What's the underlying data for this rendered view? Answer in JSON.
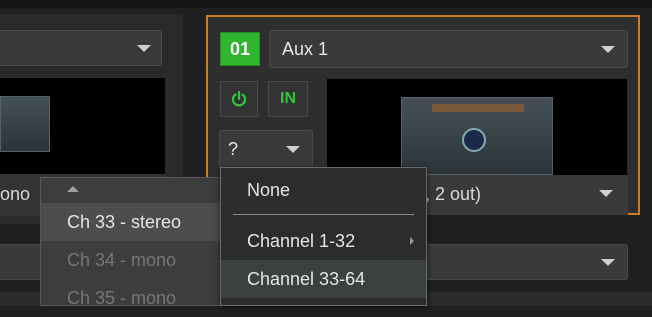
{
  "left_panel": {
    "dropdown_value": "",
    "partial_label": "ono"
  },
  "right_panel": {
    "track_number": "01",
    "name_dropdown": "Aux 1",
    "power_icon": "power-icon",
    "in_button": "IN",
    "help_select": "?",
    "plugin_label": ", 2 out)"
  },
  "menu_channels": {
    "items": [
      "Ch 33 - stereo",
      "Ch 34 - mono",
      "Ch 35 - mono"
    ]
  },
  "menu_source": {
    "items": [
      "None",
      "Channel 1-32",
      "Channel 33-64"
    ]
  },
  "colors": {
    "accent_orange": "#d07a22",
    "badge_green": "#2fb52f",
    "icon_green": "#2fc93a"
  }
}
